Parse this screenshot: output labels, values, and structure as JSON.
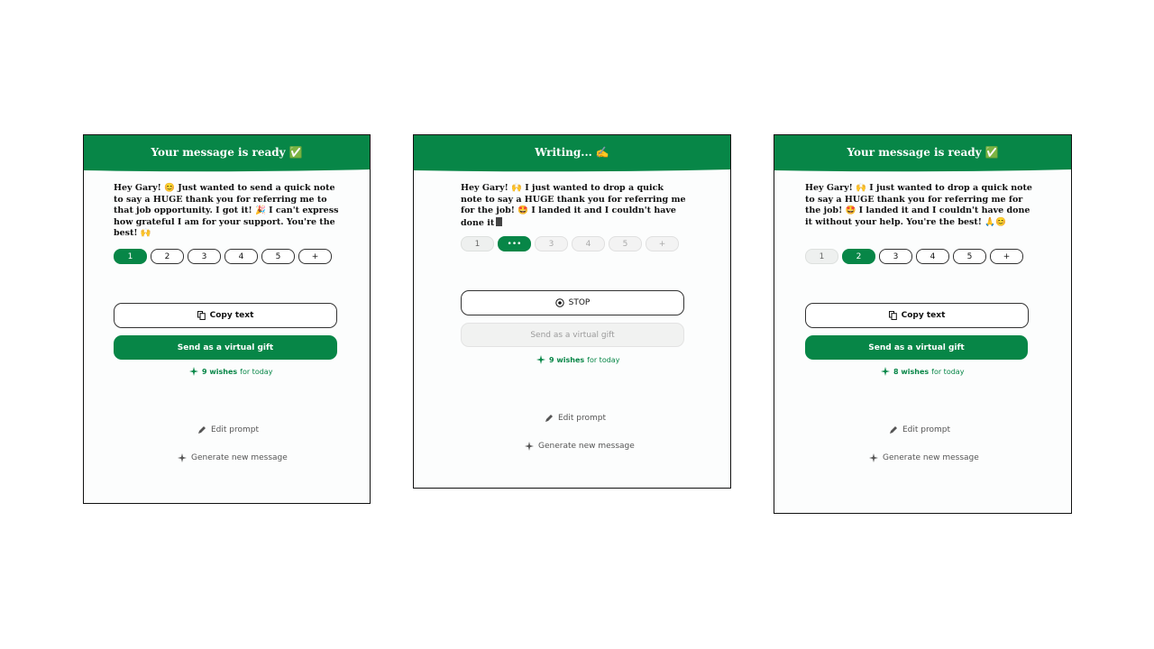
{
  "cards": [
    {
      "title": "Your message is ready",
      "title_emoji": "✅",
      "message": "Hey Gary! 😊 Just wanted to send a quick note to say a HUGE thank you for referring me to that job opportunity. I got it! 🎉 I can't express how grateful I am for your support. You're the best! 🙌",
      "versions": [
        "1",
        "2",
        "3",
        "4",
        "5",
        "+"
      ],
      "active_version": "1",
      "copy_label": "Copy text",
      "gift_label": "Send as a virtual gift",
      "wishes_count": "9 wishes",
      "wishes_suffix": "for today",
      "edit_label": "Edit prompt",
      "generate_label": "Generate new message"
    },
    {
      "title": "Writing...",
      "title_emoji": "✍️",
      "message": "Hey Gary! 🙌 I just wanted to drop a quick note to say a HUGE thank you for referring me for the job! 🤩 I landed it and I couldn't have done it",
      "versions": [
        "1",
        "•••",
        "3",
        "4",
        "5",
        "+"
      ],
      "active_version": "•••",
      "stop_label": "STOP",
      "gift_label": "Send as a virtual gift",
      "wishes_count": "9 wishes",
      "wishes_suffix": "for today",
      "edit_label": "Edit prompt",
      "generate_label": "Generate new message"
    },
    {
      "title": "Your message is ready",
      "title_emoji": "✅",
      "message": "Hey Gary! 🙌 I just wanted to drop a quick note to say a HUGE thank you for referring me for the job! 🤩 I landed it and I couldn't have done it without your help. You're the best! 🙏😊",
      "versions": [
        "1",
        "2",
        "3",
        "4",
        "5",
        "+"
      ],
      "active_version": "2",
      "copy_label": "Copy text",
      "gift_label": "Send as a virtual gift",
      "wishes_count": "8 wishes",
      "wishes_suffix": "for today",
      "edit_label": "Edit prompt",
      "generate_label": "Generate new message"
    }
  ],
  "colors": {
    "brand_green": "#078647",
    "text": "#111111",
    "muted_text": "#555555",
    "disabled_bg": "#f1f2f1"
  }
}
